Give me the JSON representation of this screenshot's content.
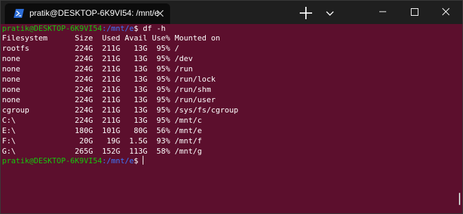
{
  "tab": {
    "title": "pratik@DESKTOP-6K9VI54: /mnt/e",
    "icon": "powershell-icon"
  },
  "window_controls": {
    "new_tab_icon": "plus-icon",
    "dropdown_icon": "chevron-down-icon",
    "minimize_icon": "minimize-icon",
    "maximize_icon": "maximize-icon",
    "close_icon": "close-icon"
  },
  "colors": {
    "terminal_bg": "#5c0f2d",
    "titlebar_bg": "#1f1f1f",
    "prompt_user": "#16c60c",
    "prompt_path": "#3b78ff"
  },
  "terminal": {
    "prompt1": {
      "user_host": "pratik@DESKTOP-6K9VI54",
      "path": ":/mnt/e",
      "symbol": "$",
      "command": " df -h"
    },
    "output_lines": [
      "Filesystem      Size  Used Avail Use% Mounted on",
      "rootfs          224G  211G   13G  95% /",
      "none            224G  211G   13G  95% /dev",
      "none            224G  211G   13G  95% /run",
      "none            224G  211G   13G  95% /run/lock",
      "none            224G  211G   13G  95% /run/shm",
      "none            224G  211G   13G  95% /run/user",
      "cgroup          224G  211G   13G  95% /sys/fs/cgroup",
      "C:\\             224G  211G   13G  95% /mnt/c",
      "E:\\             180G  101G   80G  56% /mnt/e",
      "F:\\              20G   19G  1.5G  93% /mnt/f",
      "G:\\             265G  152G  113G  58% /mnt/g"
    ],
    "prompt2": {
      "user_host": "pratik@DESKTOP-6K9VI54",
      "path": ":/mnt/e",
      "symbol": "$"
    }
  }
}
